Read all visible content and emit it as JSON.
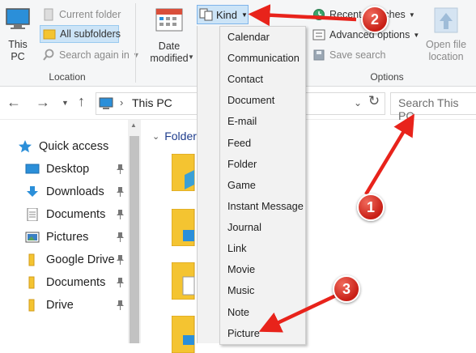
{
  "ribbon": {
    "location_group": {
      "this_pc_label": "This\nPC",
      "current_folder": "Current folder",
      "all_subfolders": "All subfolders",
      "search_again_in": "Search again in",
      "group_label": "Location"
    },
    "date_modified": "Date\nmodified",
    "kind_label": "Kind",
    "recent_searches": "Recent searches",
    "advanced_options": "Advanced options",
    "save_search": "Save search",
    "open_file_location": "Open file\nlocation",
    "options_label": "Options"
  },
  "address_bar": {
    "path": "This PC",
    "search_placeholder": "Search This PC"
  },
  "nav_pane": {
    "quick_access": "Quick access",
    "items": [
      {
        "label": "Desktop",
        "icon": "desktop-icon",
        "pinned": true
      },
      {
        "label": "Downloads",
        "icon": "downloads-icon",
        "pinned": true
      },
      {
        "label": "Documents",
        "icon": "documents-icon",
        "pinned": true
      },
      {
        "label": "Pictures",
        "icon": "pictures-icon",
        "pinned": true
      },
      {
        "label": "Google Drive",
        "icon": "folder-icon",
        "pinned": true
      },
      {
        "label": "Documents",
        "icon": "folder-icon",
        "pinned": true
      },
      {
        "label": "Drive",
        "icon": "folder-icon",
        "pinned": true
      }
    ]
  },
  "content": {
    "section_label": "Folder"
  },
  "kind_menu": {
    "items": [
      "Calendar",
      "Communication",
      "Contact",
      "Document",
      "E-mail",
      "Feed",
      "Folder",
      "Game",
      "Instant Message",
      "Journal",
      "Link",
      "Movie",
      "Music",
      "Note",
      "Picture"
    ]
  },
  "annotations": {
    "badge_1": "1",
    "badge_2": "2",
    "badge_3": "3",
    "arrow_color": "#e8231b"
  },
  "colors": {
    "accent": "#cce4f7",
    "accent_border": "#7eb4ea",
    "ribbon_bg": "#f5f6f7",
    "menu_bg": "#f2f2f2"
  }
}
